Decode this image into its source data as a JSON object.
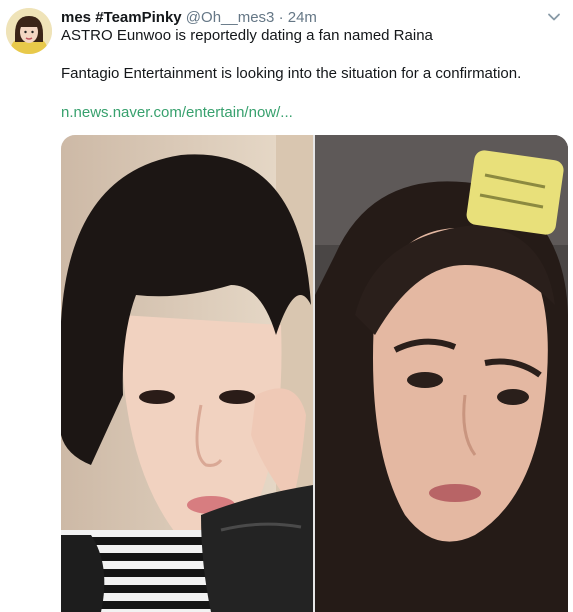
{
  "tweet": {
    "display_name": "mes #TeamPinky",
    "handle": "@Oh__mes3",
    "separator": "·",
    "time": "24m",
    "text_line_1": "ASTRO Eunwoo is reportedly dating a fan named Raina",
    "text_line_2": "Fantagio Entertainment is looking into the situation for a confirmation.",
    "link_text": "n.news.naver.com/entertain/now/..."
  },
  "icons": {
    "caret": "chevron-down-icon"
  },
  "colors": {
    "link": "#38a16e",
    "secondary_text": "#657786",
    "primary_text": "#14171a"
  }
}
